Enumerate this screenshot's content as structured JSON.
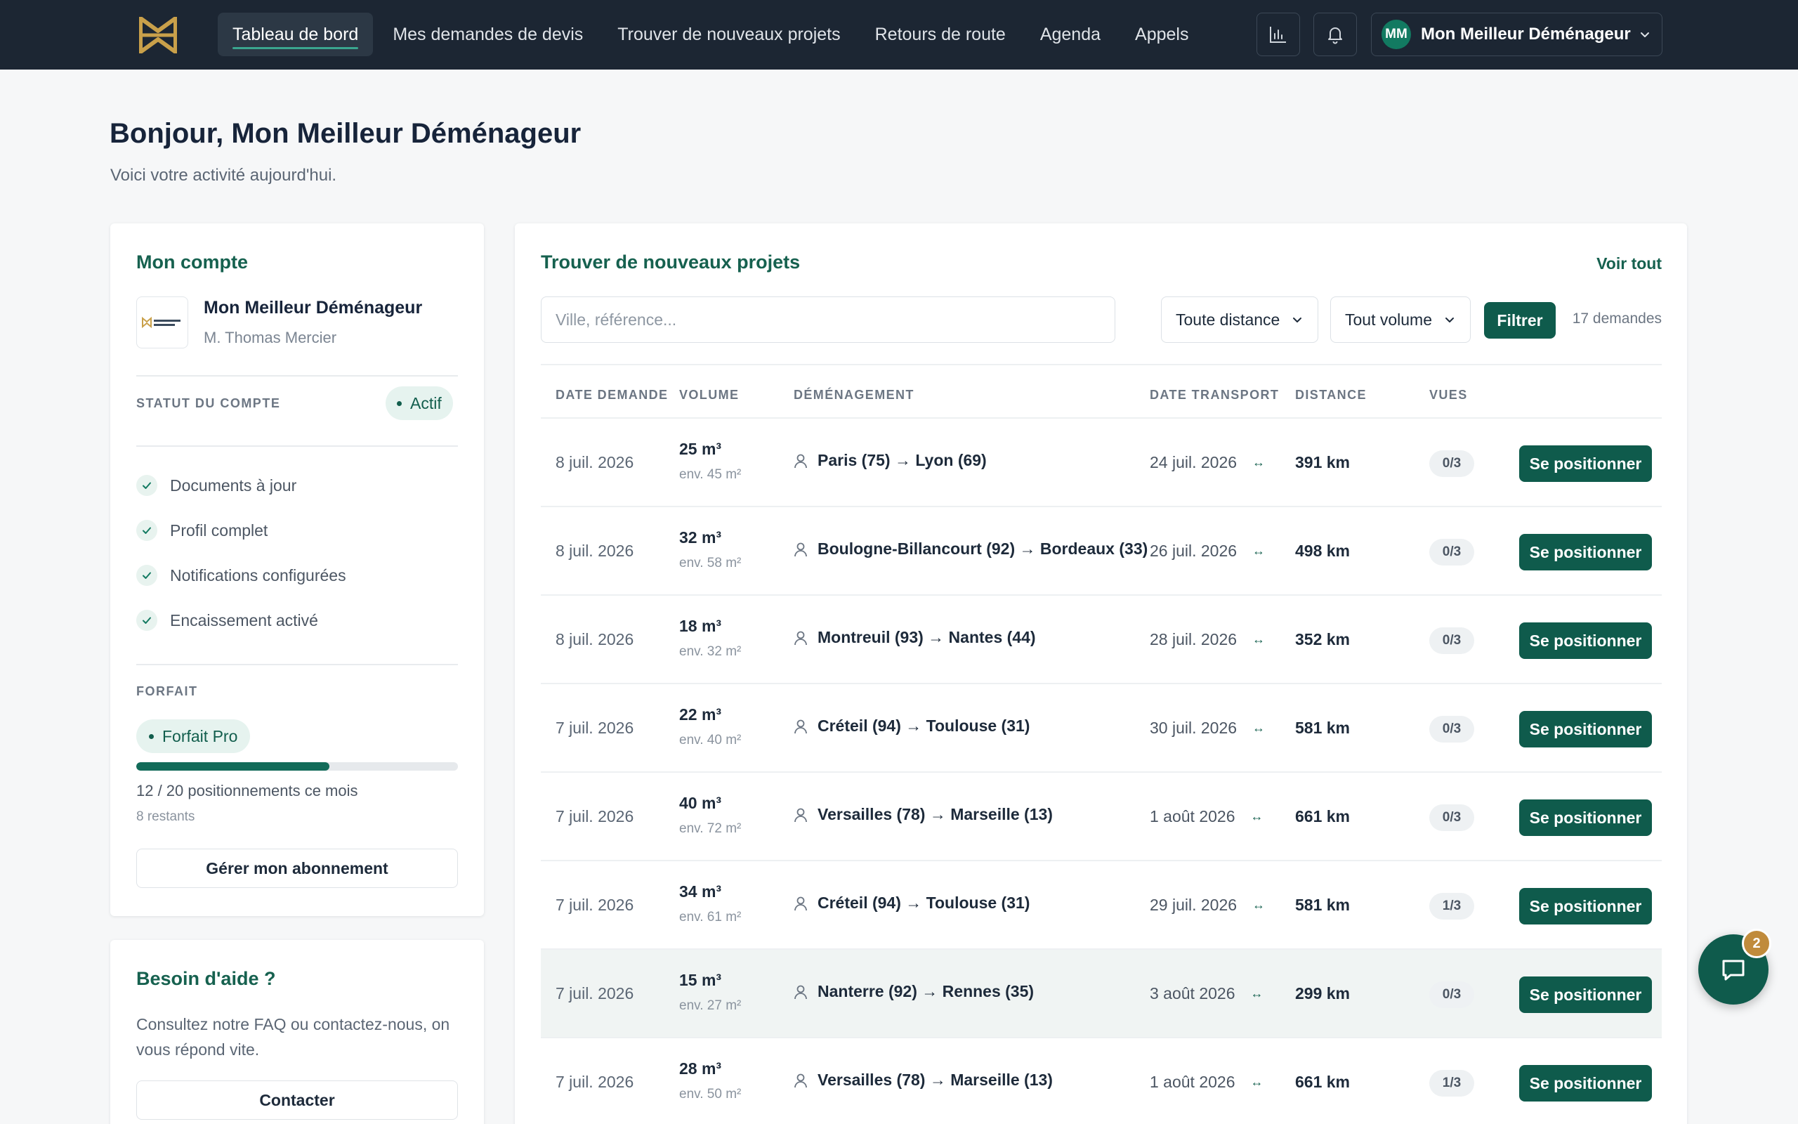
{
  "colors": {
    "nav_bg": "#1c2633",
    "brand": "#0f5b4c",
    "accent_title": "#16614f",
    "badge": "#c08b3c"
  },
  "nav": {
    "items": [
      {
        "label": "Tableau de bord",
        "active": true
      },
      {
        "label": "Mes demandes de devis"
      },
      {
        "label": "Trouver de nouveaux projets"
      },
      {
        "label": "Retours de route"
      },
      {
        "label": "Agenda"
      },
      {
        "label": "Appels"
      }
    ],
    "icons": [
      "bar-chart-icon",
      "bell-icon"
    ],
    "user": {
      "initials": "MM",
      "name": "Mon Meilleur Déménageur"
    }
  },
  "header": {
    "title": "Bonjour, Mon Meilleur Déménageur",
    "subtitle": "Voici votre activité aujourd'hui."
  },
  "account": {
    "title": "Mon compte",
    "company": "Mon Meilleur Déménageur",
    "contact": "M. Thomas Mercier",
    "status_label": "STATUT DU COMPTE",
    "status": "Actif",
    "checklist": [
      "Documents à jour",
      "Profil complet",
      "Notifications configurées",
      "Encaissement activé"
    ],
    "plan_label": "FORFAIT",
    "plan": "Forfait Pro",
    "usage_used": 12,
    "usage_total": 20,
    "usage_text": "12 / 20 positionnements ce mois",
    "remaining": "8 restants",
    "manage_button": "Gérer mon abonnement"
  },
  "help": {
    "title": "Besoin d'aide ?",
    "text": "Consultez notre FAQ ou contactez-nous, on vous répond vite.",
    "button": "Contacter"
  },
  "projects": {
    "title": "Trouver de nouveaux projets",
    "see_all": "Voir tout",
    "search_placeholder": "Ville, référence...",
    "distance_filter": "Toute distance",
    "volume_filter": "Tout volume",
    "filter_button": "Filtrer",
    "count": "17 demandes",
    "columns": [
      "DATE DEMANDE",
      "VOLUME",
      "DÉMÉNAGEMENT",
      "DATE TRANSPORT",
      "DISTANCE",
      "VUES"
    ],
    "action_label": "Se positionner",
    "rows": [
      {
        "date": "8 juil. 2026",
        "volume": "25 m³",
        "surface": "env. 45 m²",
        "route": "Paris (75) → Lyon (69)",
        "transport": "24 juil. 2026",
        "distance": "391 km",
        "views": "0/3"
      },
      {
        "date": "8 juil. 2026",
        "volume": "32 m³",
        "surface": "env. 58 m²",
        "route": "Boulogne-Billancourt (92) → Bordeaux (33)",
        "transport": "26 juil. 2026",
        "distance": "498 km",
        "views": "0/3"
      },
      {
        "date": "8 juil. 2026",
        "volume": "18 m³",
        "surface": "env. 32 m²",
        "route": "Montreuil (93) → Nantes (44)",
        "transport": "28 juil. 2026",
        "distance": "352 km",
        "views": "0/3"
      },
      {
        "date": "7 juil. 2026",
        "volume": "22 m³",
        "surface": "env. 40 m²",
        "route": "Créteil (94) → Toulouse (31)",
        "transport": "30 juil. 2026",
        "distance": "581 km",
        "views": "0/3"
      },
      {
        "date": "7 juil. 2026",
        "volume": "40 m³",
        "surface": "env. 72 m²",
        "route": "Versailles (78) → Marseille (13)",
        "transport": "1 août 2026",
        "distance": "661 km",
        "views": "0/3"
      },
      {
        "date": "7 juil. 2026",
        "volume": "34 m³",
        "surface": "env. 61 m²",
        "route": "Créteil (94) → Toulouse (31)",
        "transport": "29 juil. 2026",
        "distance": "581 km",
        "views": "1/3"
      },
      {
        "date": "7 juil. 2026",
        "volume": "15 m³",
        "surface": "env. 27 m²",
        "route": "Nanterre (92) → Rennes (35)",
        "transport": "3 août 2026",
        "distance": "299 km",
        "views": "0/3"
      },
      {
        "date": "7 juil. 2026",
        "volume": "28 m³",
        "surface": "env. 50 m²",
        "route": "Versailles (78) → Marseille (13)",
        "transport": "1 août 2026",
        "distance": "661 km",
        "views": "1/3"
      }
    ]
  },
  "chat": {
    "badge": "2"
  }
}
